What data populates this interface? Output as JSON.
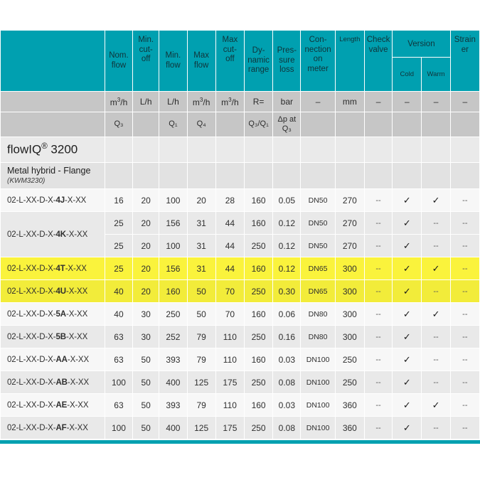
{
  "table": {
    "header": {
      "columns": [
        {
          "label": "Nom. flow"
        },
        {
          "label": "Min. cut-off"
        },
        {
          "label": "Min. flow"
        },
        {
          "label": "Max flow"
        },
        {
          "label": "Max cut-off"
        },
        {
          "label": "Dy-namic range"
        },
        {
          "label": "Pres-sure loss"
        },
        {
          "label": "Con-nection on meter"
        },
        {
          "label": "Length"
        },
        {
          "label": "Check valve"
        },
        {
          "label": "Version"
        },
        {
          "label": "Cold"
        },
        {
          "label": "Warm"
        },
        {
          "label": "Strain er"
        }
      ],
      "nom_flow": "Nom.\nflow",
      "min_cutoff": "Min.\ncut-\noff",
      "min_flow": "Min.\nflow",
      "max_flow": "Max\nflow",
      "max_cutoff": "Max\ncut-\noff",
      "dynamic_range": "Dy-\nnamic\nrange",
      "pressure_loss": "Pres-\nsure\nloss",
      "connection": "Con-\nnection\non\nmeter",
      "length": "Length",
      "check_valve": "Check\nvalve",
      "version": "Version",
      "cold": "Cold",
      "warm": "Warm",
      "strainer": "Strain\ner"
    },
    "units": {
      "nom_flow": "m³/h",
      "min_cutoff": "L/h",
      "min_flow": "L/h",
      "max_flow": "m³/h",
      "max_cutoff": "m³/h",
      "dynamic_range": "R=",
      "pressure_loss": "bar",
      "connection": "–",
      "length": "mm",
      "check_valve": "–",
      "cold": "–",
      "warm": "–",
      "strainer": "–"
    },
    "symbols": {
      "nom_flow": "Q₃",
      "min_cutoff": "",
      "min_flow": "Q₁",
      "max_flow": "Q₄",
      "max_cutoff": "",
      "dynamic_range": "Q₃/Q₁",
      "pressure_loss": "Δp at Q₃",
      "connection": "",
      "length": "",
      "check_valve": "",
      "cold": "",
      "warm": "",
      "strainer": ""
    },
    "product": {
      "title": "flowIQ® 3200",
      "title_main": "flowIQ",
      "title_sup": "®",
      "title_num": " 3200",
      "variant": "Metal hybrid - Flange",
      "variant_code": "(KWM3230)"
    },
    "rows": [
      {
        "name": "02-L-XX-D-X-4J-X-XX",
        "name_prefix": "02-L-XX-D-X-",
        "name_key": "4J",
        "name_suffix": "-X-XX",
        "rowspan": 1,
        "highlight": false,
        "shade": "a",
        "values": [
          "16",
          "20",
          "100",
          "20",
          "28",
          "160",
          "0.05",
          "DN50",
          "270",
          "--",
          "✓",
          "✓",
          "--"
        ]
      },
      {
        "name": "02-L-XX-D-X-4K-X-XX",
        "name_prefix": "02-L-XX-D-X-",
        "name_key": "4K",
        "name_suffix": "-X-XX",
        "rowspan": 2,
        "highlight": false,
        "shade": "b",
        "values": [
          "25",
          "20",
          "156",
          "31",
          "44",
          "160",
          "0.12",
          "DN50",
          "270",
          "--",
          "✓",
          "--",
          "--"
        ]
      },
      {
        "name": "",
        "rowspan": 0,
        "highlight": false,
        "shade": "b",
        "values": [
          "25",
          "20",
          "100",
          "31",
          "44",
          "250",
          "0.12",
          "DN50",
          "270",
          "--",
          "✓",
          "--",
          "--"
        ]
      },
      {
        "name": "02-L-XX-D-X-4T-X-XX",
        "name_prefix": "02-L-XX-D-X-",
        "name_key": "4T",
        "name_suffix": "-X-XX",
        "rowspan": 1,
        "highlight": true,
        "shade": "hl-a",
        "values": [
          "25",
          "20",
          "156",
          "31",
          "44",
          "160",
          "0.12",
          "DN65",
          "300",
          "--",
          "✓",
          "✓",
          "--"
        ]
      },
      {
        "name": "02-L-XX-D-X-4U-X-XX",
        "name_prefix": "02-L-XX-D-X-",
        "name_key": "4U",
        "name_suffix": "-X-XX",
        "rowspan": 1,
        "highlight": true,
        "shade": "hl-b",
        "values": [
          "40",
          "20",
          "160",
          "50",
          "70",
          "250",
          "0.30",
          "DN65",
          "300",
          "--",
          "✓",
          "--",
          "--"
        ]
      },
      {
        "name": "02-L-XX-D-X-5A-X-XX",
        "name_prefix": "02-L-XX-D-X-",
        "name_key": "5A",
        "name_suffix": "-X-XX",
        "rowspan": 1,
        "highlight": false,
        "shade": "a",
        "values": [
          "40",
          "30",
          "250",
          "50",
          "70",
          "160",
          "0.06",
          "DN80",
          "300",
          "--",
          "✓",
          "✓",
          "--"
        ]
      },
      {
        "name": "02-L-XX-D-X-5B-X-XX",
        "name_prefix": "02-L-XX-D-X-",
        "name_key": "5B",
        "name_suffix": "-X-XX",
        "rowspan": 1,
        "highlight": false,
        "shade": "b",
        "values": [
          "63",
          "30",
          "252",
          "79",
          "110",
          "250",
          "0.16",
          "DN80",
          "300",
          "--",
          "✓",
          "--",
          "--"
        ]
      },
      {
        "name": "02-L-XX-D-X-AA-X-XX",
        "name_prefix": "02-L-XX-D-X-",
        "name_key": "AA",
        "name_suffix": "-X-XX",
        "rowspan": 1,
        "highlight": false,
        "shade": "a",
        "values": [
          "63",
          "50",
          "393",
          "79",
          "110",
          "160",
          "0.03",
          "DN100",
          "250",
          "--",
          "✓",
          "--",
          "--"
        ]
      },
      {
        "name": "02-L-XX-D-X-AB-X-XX",
        "name_prefix": "02-L-XX-D-X-",
        "name_key": "AB",
        "name_suffix": "-X-XX",
        "rowspan": 1,
        "highlight": false,
        "shade": "b",
        "values": [
          "100",
          "50",
          "400",
          "125",
          "175",
          "250",
          "0.08",
          "DN100",
          "250",
          "--",
          "✓",
          "--",
          "--"
        ]
      },
      {
        "name": "02-L-XX-D-X-AE-X-XX",
        "name_prefix": "02-L-XX-D-X-",
        "name_key": "AE",
        "name_suffix": "-X-XX",
        "rowspan": 1,
        "highlight": false,
        "shade": "a",
        "values": [
          "63",
          "50",
          "393",
          "79",
          "110",
          "160",
          "0.03",
          "DN100",
          "360",
          "--",
          "✓",
          "✓",
          "--"
        ]
      },
      {
        "name": "02-L-XX-D-X-AF-X-XX",
        "name_prefix": "02-L-XX-D-X-",
        "name_key": "AF",
        "name_suffix": "-X-XX",
        "rowspan": 1,
        "highlight": false,
        "shade": "b",
        "values": [
          "100",
          "50",
          "400",
          "125",
          "175",
          "250",
          "0.08",
          "DN100",
          "360",
          "--",
          "✓",
          "--",
          "--"
        ]
      }
    ]
  },
  "colors": {
    "teal": "#00a0b0",
    "highlight_yellow": "#faf33c",
    "header_grey": "#c6c6c6",
    "row_light": "#f7f7f7",
    "row_dark": "#e9e9e9"
  }
}
